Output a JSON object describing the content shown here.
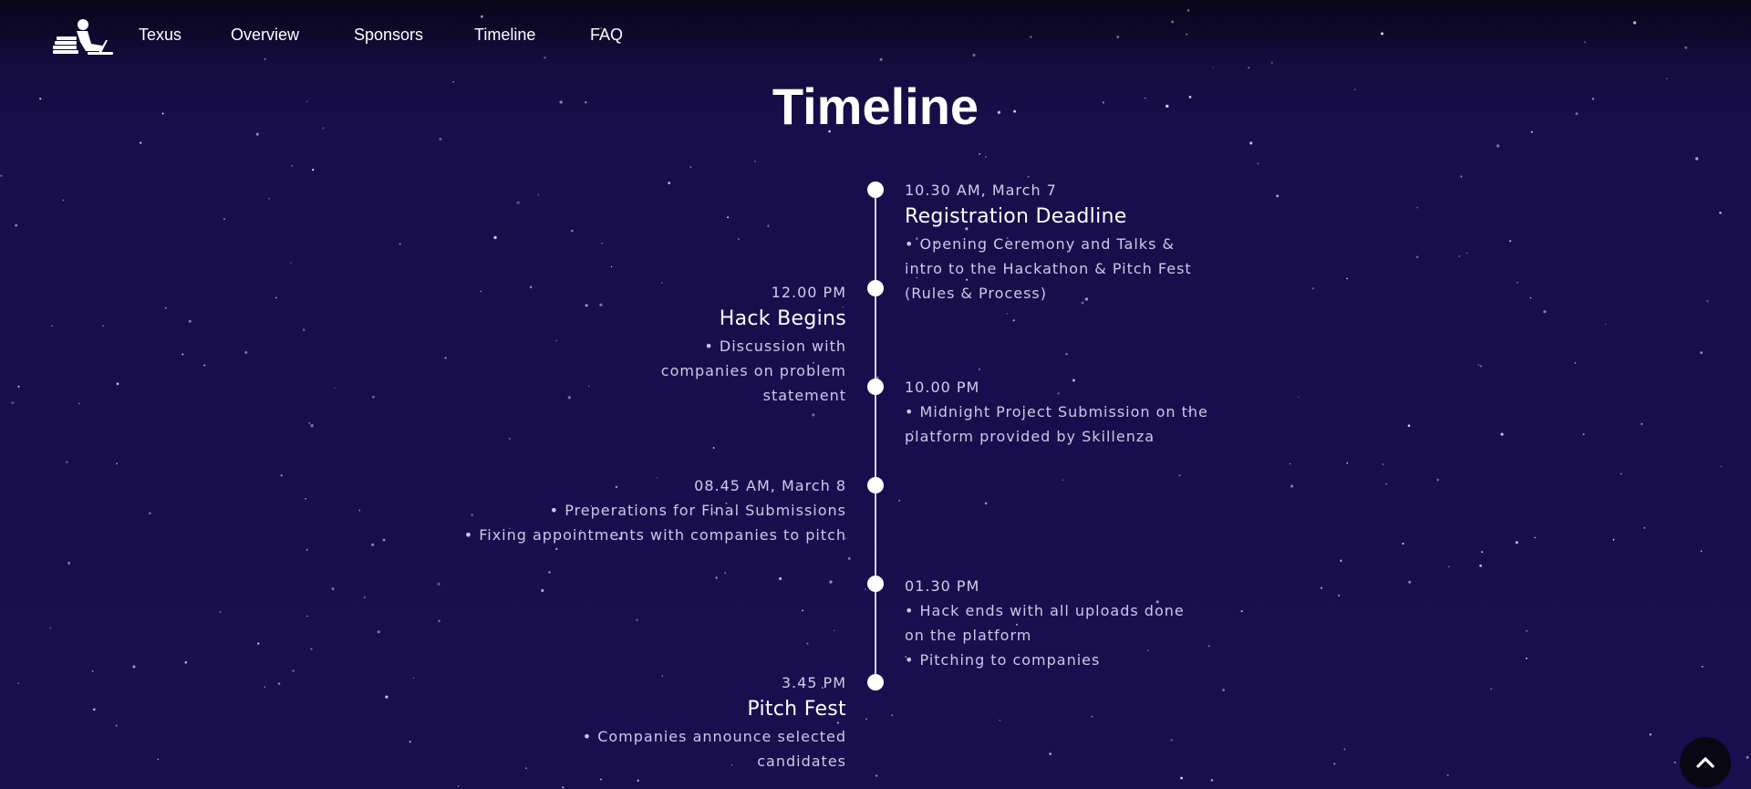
{
  "nav": {
    "logo_icon": "person-at-laptop-logo-icon",
    "links": [
      "Texus",
      "Overview",
      "Sponsors",
      "Timeline",
      "FAQ"
    ]
  },
  "page_title": "Timeline",
  "timeline": [
    {
      "side": "right",
      "time": "10.30 AM, March 7",
      "heading": "Registration Deadline",
      "description": [
        "• Opening Ceremony and Talks &",
        "intro to the Hackathon & Pitch Fest",
        "(Rules & Process)"
      ]
    },
    {
      "side": "left",
      "time": "12.00 PM",
      "heading": "Hack Begins",
      "description": [
        "• Discussion with",
        "companies on problem",
        "statement"
      ]
    },
    {
      "side": "right",
      "time": "10.00 PM",
      "heading": "",
      "description": [
        "• Midnight Project Submission on the",
        "platform provided by Skillenza"
      ]
    },
    {
      "side": "left",
      "time": "08.45 AM, March 8",
      "heading": "",
      "description": [
        "• Preperations for Final Submissions",
        "• Fixing appointments with companies to pitch"
      ]
    },
    {
      "side": "right",
      "time": "01.30 PM",
      "heading": "",
      "description": [
        "• Hack ends with all uploads done",
        "on the platform",
        "• Pitching to companies"
      ]
    },
    {
      "side": "left",
      "time": "3.45 PM",
      "heading": "Pitch Fest",
      "description": [
        "• Companies announce selected",
        "candidates"
      ]
    }
  ],
  "scroll_top": {
    "icon": "chevron-up-icon"
  },
  "colors": {
    "background": "#190e4e",
    "navbar_top": "#080518",
    "text": "#ffffff",
    "muted_text": "#cdc8e4",
    "timeline_line": "#d8d4ee",
    "scroll_button": "#090713"
  }
}
